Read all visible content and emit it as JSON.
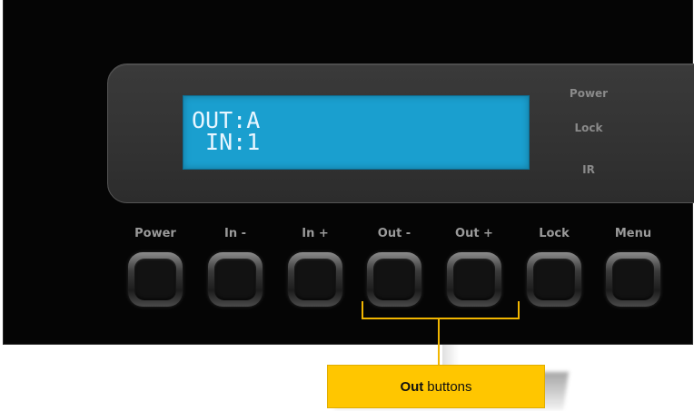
{
  "lcd": {
    "line1": "OUT:A",
    "line2": " IN:1",
    "background": "#1a9fcf",
    "text_color": "#e8f6ff"
  },
  "indicators": {
    "power": "Power",
    "lock": "Lock",
    "ir": "IR"
  },
  "buttons": [
    {
      "label": "Power"
    },
    {
      "label": "In -"
    },
    {
      "label": "In +"
    },
    {
      "label": "Out -"
    },
    {
      "label": "Out +"
    },
    {
      "label": "Lock"
    },
    {
      "label": "Menu"
    }
  ],
  "callout": {
    "bold_text": "Out",
    "text": "buttons",
    "color": "#ffc600",
    "bracket_color": "#f2b600"
  }
}
